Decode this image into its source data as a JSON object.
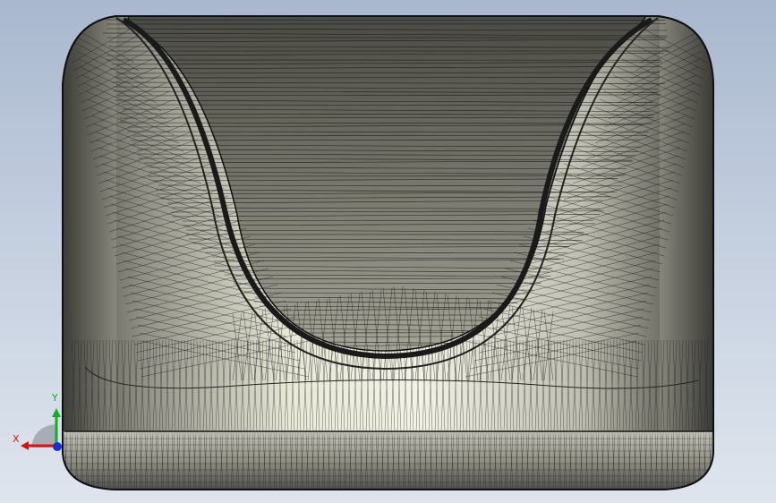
{
  "viewport": {
    "background_top": "#a9b8cf",
    "background_bottom": "#dfe5ee"
  },
  "model": {
    "display_mode": "shaded-with-mesh-edges",
    "body_color": "#9a9a90",
    "highlight_color": "#f2f2e2",
    "edge_color": "#111111"
  },
  "triad": {
    "x_label": "X",
    "y_label": "Y",
    "x_color": "#e01010",
    "y_color": "#10b020",
    "z_color": "#1030e0"
  }
}
